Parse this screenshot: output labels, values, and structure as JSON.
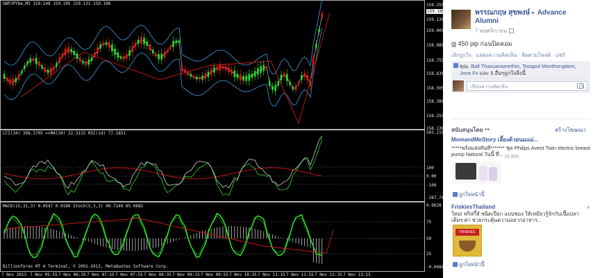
{
  "chart": {
    "price_title": "GBPJPYbe,M5  159.148 159.195 159.131 159.186",
    "price_axis": [
      "159.255",
      "159.186",
      "159.130",
      "159.005",
      "158.880",
      "158.755",
      "158.630",
      "158.505",
      "158.380",
      "158.255",
      "158.130"
    ],
    "ind1_title": "CCI(34) 398.3705  >>MA(20) 22.3115  RSI(14) 77.1851",
    "ind1_axis": [
      "503.2150",
      "100",
      "0.00",
      "-100",
      "-287.7469"
    ],
    "ind2_title": "MACD(15,31,3) 0.0547 0.0180  Stoch(5,3,3) 90.7149 85.0882",
    "ind2_axis": [
      "0.0628",
      "75",
      "50",
      "25",
      "-0.0484"
    ],
    "time_labels": [
      "7 Nov 2013",
      "7 Nov 05:55",
      "7 Nov 06:35",
      "7 Nov 07:15",
      "7 Nov 07:55",
      "7 Nov 08:35",
      "7 Nov 09:15",
      "7 Nov 09:55",
      "7 Nov 10:35",
      "7 Nov 11:15",
      "7 Nov 11:55",
      "7 Nov 12:35",
      "7 Nov 13:15"
    ],
    "copyright": "Billionforex MT 4 Terminal, © 2001-2013, MetaQuotes Software Corp.",
    "colors": {
      "bull": "#2ad82a",
      "bear": "#e01818",
      "bands": "#3aa0e0",
      "ma": "#d01818",
      "cci": "#e8e8e8",
      "rsi": "#2ad82a",
      "macd_hist": "#e8e8e8",
      "stoch_main": "#2ad82a",
      "stoch_signal": "#2ad82a"
    }
  },
  "fb": {
    "author": "พรรณกฤษ สุขพงษ์",
    "separator": "▸",
    "group": "Advance Alumni",
    "time": "7 พฤศจิกายน",
    "post_text": "gj 450 pip ก่อนปิดคอม",
    "actions": [
      "เลิกถูกใจ",
      "แสดงความคิดเห็น",
      "ติดตามโพสต์",
      "แชร์"
    ],
    "likes_prefix": "คุณ,",
    "likes_names": "Ball Thassanamethin, Tosapol Monthongtiem, Jone Fx",
    "likes_suffix": "และ 5 อื่นๆถูกใจสิ่งนี้",
    "comment_placeholder": "เขียนความคิดเห็น",
    "sponsored_label": "สนับสนุนโดย ⁹⁶",
    "create_ad": "สร้างโฆษณา",
    "ad1": {
      "title": "MomandMeStory เลี้ยงด้วยนมแม่...",
      "body": "*****พร้อมส่งทันที******* ชุด Philips Avent Twin electric breast pump Natural วันนี้ ที่...",
      "price": "15,900",
      "like": "ถูกใจหน้านี้"
    },
    "ad2": {
      "title": "FriskiesThailand",
      "body": "ใหม่! ฟริสกี้ส์ ชนิดเปียก แบบซอง ให้เหมียวรู้จักกับเนื้อปลาเต็มๆ ค่า ช่วยกระตุ้นความอยากอาหาร...",
      "like": "ถูกใจหน้านี้",
      "close": "×",
      "pack_label": "FRISKIES"
    }
  }
}
